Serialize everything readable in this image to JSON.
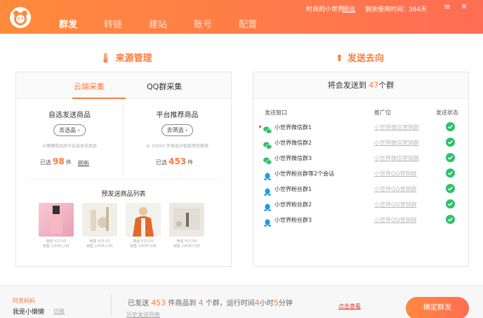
{
  "header": {
    "nav": [
      "群发",
      "转链",
      "建站",
      "账号",
      "配置"
    ],
    "active_nav": "群发",
    "user_label": "时尚的小世界",
    "logout_label": "退出",
    "remaining_label": "剩余使用时间：",
    "remaining_value": "364天",
    "menu_icon": "≡",
    "close_icon": "✕"
  },
  "source": {
    "title": "来源管理",
    "tabs": [
      "云端采集",
      "QQ群采集"
    ],
    "active_tab": "云端采集",
    "self": {
      "title": "自选发送商品",
      "button": "去选品",
      "sub": "从懒懒商品库中自选发送商品",
      "sent_label": "已选",
      "count": "98",
      "unit": "件",
      "refresh": "刷新"
    },
    "platform": {
      "title": "平台推荐商品",
      "button": "去筛选",
      "sub": "从 50000 件商品中智能筛优推荐",
      "sent_label": "已选",
      "count": "453",
      "unit": "件"
    },
    "preview_title": "预发送商品列表",
    "products": [
      {
        "price": "佣金 ¥23.00",
        "sales": "销售 100件/小时"
      },
      {
        "price": "佣金 ¥23.00",
        "sales": "销售 100件/小时"
      },
      {
        "price": "佣金 ¥23.00",
        "sales": "销售 100件/小时"
      },
      {
        "price": "佣金 ¥23.00",
        "sales": "销售 100件/小时"
      }
    ]
  },
  "dest": {
    "title": "发送去向",
    "head_prefix": "将会发送到",
    "group_count": "47",
    "head_suffix": "个群",
    "col_window": "发送窗口",
    "col_promo": "推广位",
    "col_status": "发送状态",
    "rows": [
      {
        "type": "wechat",
        "name": "小世界微信群1",
        "promo": "小世界微信营销群",
        "alert": true
      },
      {
        "type": "wechat",
        "name": "小世界微信群2",
        "promo": "小世界微信营销群",
        "alert": false
      },
      {
        "type": "wechat",
        "name": "小世界微信群3",
        "promo": "小世界微信营销群",
        "alert": false
      },
      {
        "type": "qq",
        "name": "小世界粉丝群等2个会话",
        "promo": "小世界QQ营销群",
        "alert": false
      },
      {
        "type": "qq",
        "name": "小世界粉丝群1",
        "promo": "小世界QQ营销群",
        "alert": false
      },
      {
        "type": "qq",
        "name": "小世界粉丝群2",
        "promo": "小世界QQ营销群",
        "alert": false
      },
      {
        "type": "qq",
        "name": "小世界粉丝群3",
        "promo": "小世界QQ营销群",
        "alert": false
      }
    ]
  },
  "footer": {
    "brand": "阿里妈妈",
    "username": "我是小懒懒",
    "switch": "切换",
    "s1": "已发送",
    "items": "453",
    "s2": "件商品到",
    "groups": "4",
    "s3": "个群，运行时间",
    "hours": "4",
    "s4": "小时",
    "minutes": "5",
    "s5": "分钟",
    "history": "历史发送列表",
    "view": "点击查看",
    "confirm": "确定群发"
  },
  "colors": {
    "accent": "#ff7a3c",
    "wechat": "#2fc06b",
    "qq": "#1e9be8",
    "check": "#2fc06b"
  }
}
